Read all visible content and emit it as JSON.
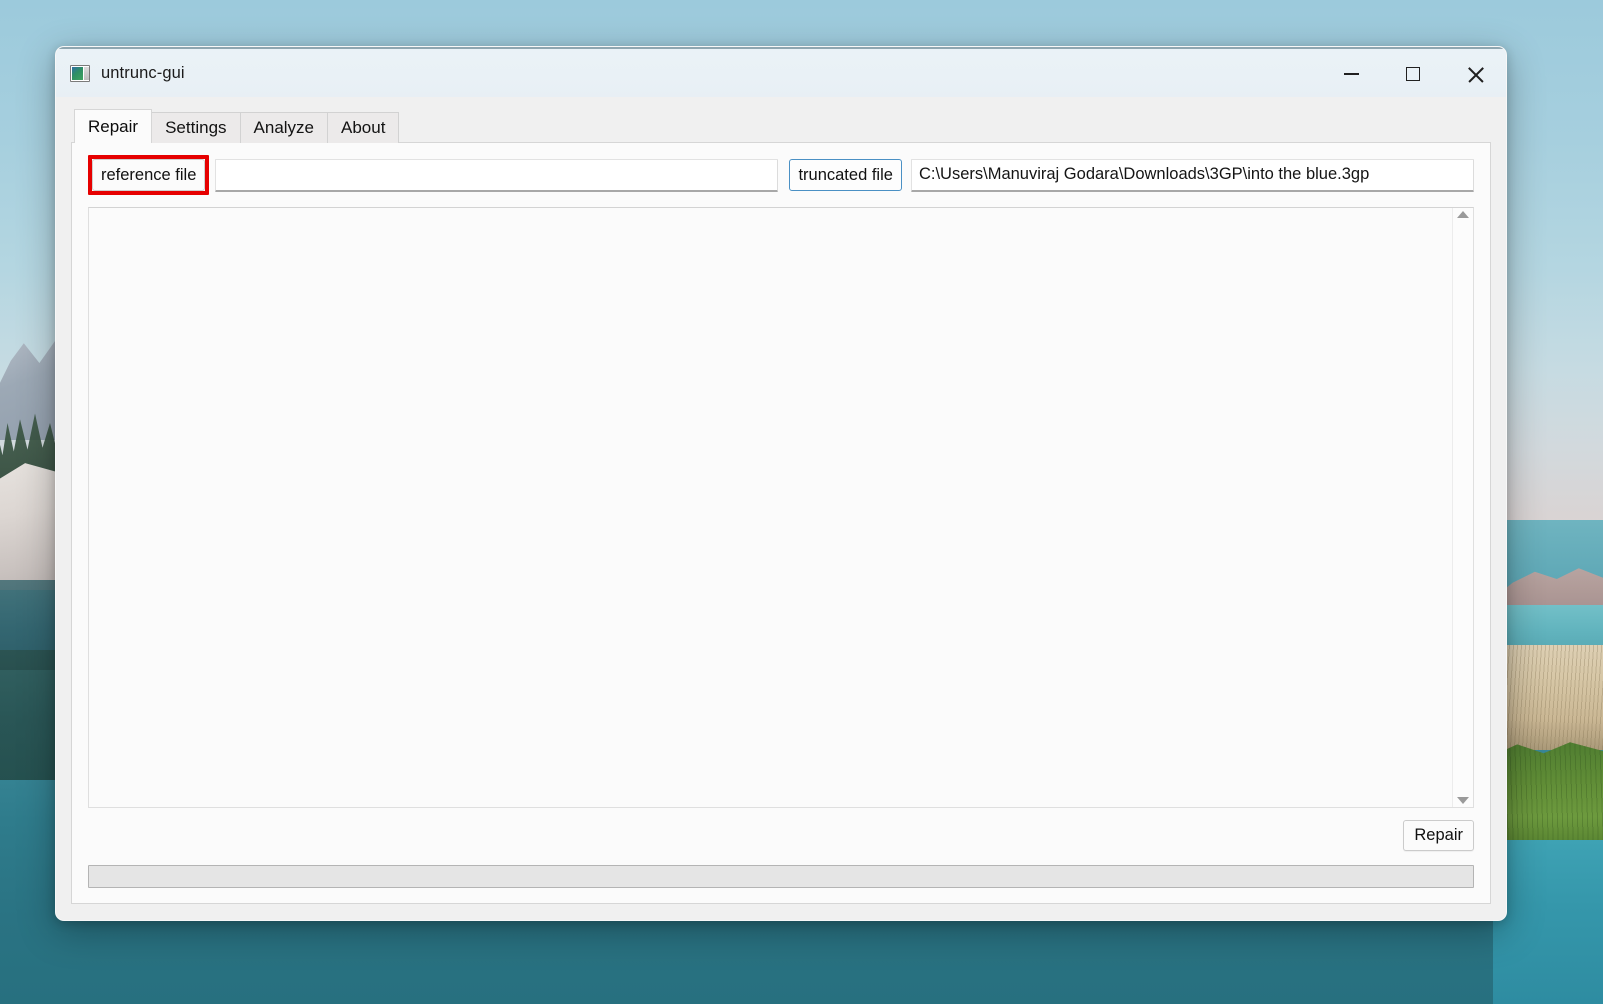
{
  "window": {
    "title": "untrunc-gui",
    "icon": "app-image-icon",
    "controls": {
      "minimize": "minimize-icon",
      "maximize": "maximize-icon",
      "close": "close-icon"
    }
  },
  "tabs": [
    {
      "id": "repair",
      "label": "Repair",
      "active": true
    },
    {
      "id": "settings",
      "label": "Settings",
      "active": false
    },
    {
      "id": "analyze",
      "label": "Analyze",
      "active": false
    },
    {
      "id": "about",
      "label": "About",
      "active": false
    }
  ],
  "repair_tab": {
    "reference_file": {
      "button_label": "reference file",
      "value": "",
      "placeholder": "",
      "highlighted": true,
      "highlight_color": "#e60000"
    },
    "truncated_file": {
      "button_label": "truncated file",
      "value": "C:\\Users\\Manuviraj Godara\\Downloads\\3GP\\into the blue.3gp",
      "placeholder": "",
      "focused": true,
      "focus_color": "#4a90c4"
    },
    "log": {
      "content": "",
      "scrollbar": {
        "up_arrow": "scroll-up-arrow-icon",
        "down_arrow": "scroll-down-arrow-icon"
      }
    },
    "repair_button_label": "Repair",
    "progress": {
      "value": 0,
      "max": 100,
      "display": "0%"
    }
  }
}
